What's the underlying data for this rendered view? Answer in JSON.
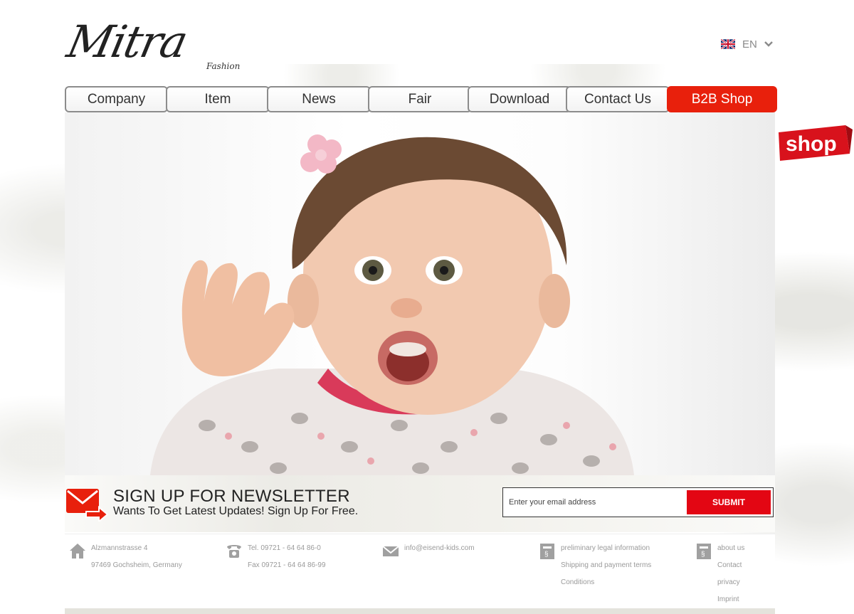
{
  "logo": {
    "main": "Mitra",
    "sub": "Fashion"
  },
  "language": {
    "label": "EN"
  },
  "nav": {
    "items": [
      {
        "label": "Company"
      },
      {
        "label": "Item"
      },
      {
        "label": "News"
      },
      {
        "label": "Fair"
      },
      {
        "label": "Download"
      },
      {
        "label": "Contact Us"
      },
      {
        "label": "B2B Shop"
      }
    ]
  },
  "shop_badge": {
    "label": "shop"
  },
  "newsletter": {
    "title": "SIGN UP FOR NEWSLETTER",
    "subtitle": "Wants To Get Latest Updates! Sign Up For Free.",
    "email_placeholder": "Enter your email address",
    "submit_label": "SUBMIT"
  },
  "footer": {
    "address": {
      "line1": "Alzmannstrasse 4",
      "line2": "97469 Gochsheim, Germany"
    },
    "phone": {
      "tel": "Tel. 09721 - 64 64 86-0",
      "fax": "Fax 09721 - 64 64 86-99"
    },
    "email": {
      "address": "info@eisend-kids.com"
    },
    "legal": {
      "line1": "preliminary legal information",
      "line2": "Shipping and payment terms",
      "line3": "Conditions"
    },
    "about": {
      "line1": "about us",
      "line2": "Contact",
      "line3": "privacy",
      "line4": "Imprint"
    }
  },
  "colors": {
    "accent": "#e8200c",
    "submit": "#e30613"
  },
  "icons": [
    "uk-flag-icon",
    "chevron-down-icon",
    "envelope-arrow-icon",
    "home-icon",
    "phone-icon",
    "mail-icon",
    "document-icon"
  ]
}
